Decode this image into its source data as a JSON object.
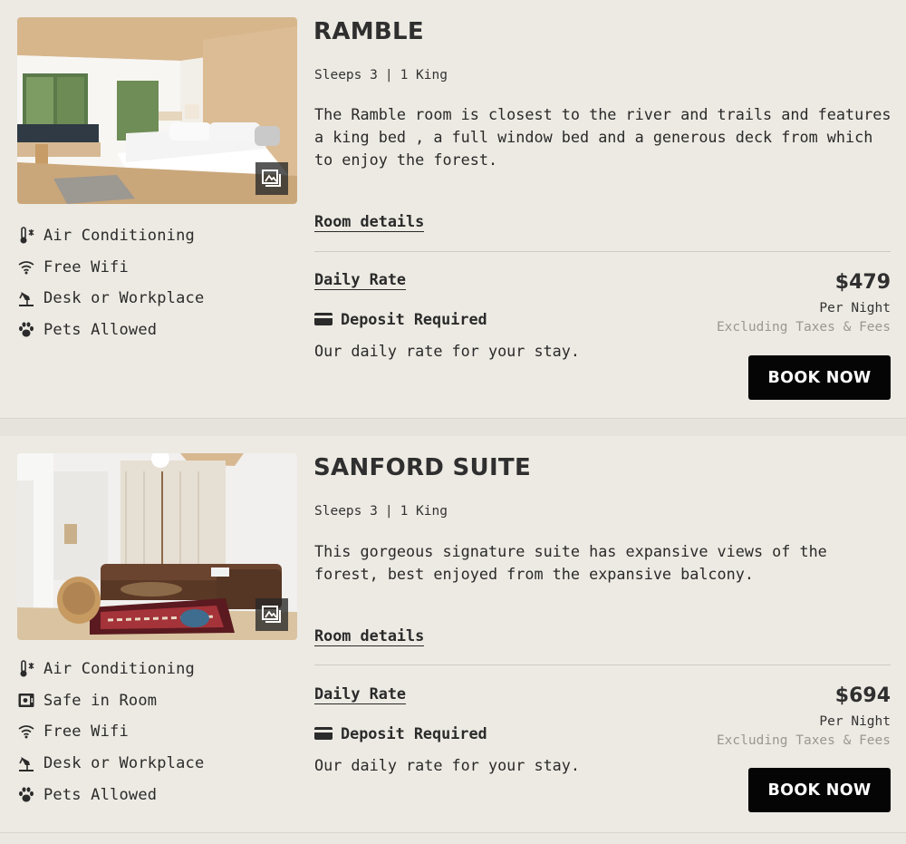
{
  "rooms": [
    {
      "name": "RAMBLE",
      "sleeps": "Sleeps 3",
      "beds": "1 King",
      "separator": "|",
      "description": "The Ramble room is closest to the river and trails and features a king bed , a full window bed and a generous deck from which to enjoy the forest.",
      "room_details_label": "Room details",
      "daily_rate_label": "Daily Rate",
      "deposit_label": "Deposit Required",
      "rate_note": "Our daily rate for your stay.",
      "price": "$479",
      "per_night": "Per Night",
      "excluding": "Excluding Taxes & Fees",
      "book_label": "BOOK NOW",
      "amenities": [
        {
          "label": "Air Conditioning",
          "icon": "thermometer-snow-icon"
        },
        {
          "label": "Free Wifi",
          "icon": "wifi-icon"
        },
        {
          "label": "Desk or Workplace",
          "icon": "desk-lamp-icon"
        },
        {
          "label": "Pets Allowed",
          "icon": "paw-icon"
        }
      ]
    },
    {
      "name": "SANFORD SUITE",
      "sleeps": "Sleeps 3",
      "beds": "1 King",
      "separator": "|",
      "description": "This gorgeous signature suite has expansive views of the forest, best enjoyed from the expansive balcony.",
      "room_details_label": "Room details",
      "daily_rate_label": "Daily Rate",
      "deposit_label": "Deposit Required",
      "rate_note": "Our daily rate for your stay.",
      "price": "$694",
      "per_night": "Per Night",
      "excluding": "Excluding Taxes & Fees",
      "book_label": "BOOK NOW",
      "amenities": [
        {
          "label": "Air Conditioning",
          "icon": "thermometer-snow-icon"
        },
        {
          "label": "Safe in Room",
          "icon": "safe-icon"
        },
        {
          "label": "Free Wifi",
          "icon": "wifi-icon"
        },
        {
          "label": "Desk or Workplace",
          "icon": "desk-lamp-icon"
        },
        {
          "label": "Pets Allowed",
          "icon": "paw-icon"
        }
      ]
    }
  ],
  "colors": {
    "background": "#edeae3",
    "button": "#050505",
    "button_text": "#ffffff",
    "muted_text": "#9a9791"
  }
}
